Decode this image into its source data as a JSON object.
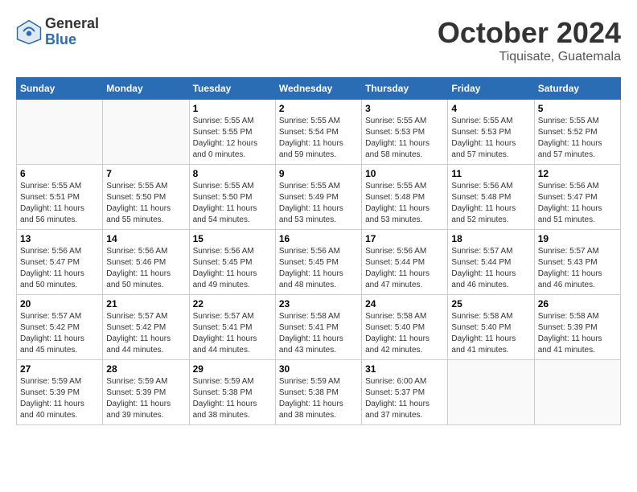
{
  "header": {
    "logo_general": "General",
    "logo_blue": "Blue",
    "month_title": "October 2024",
    "location": "Tiquisate, Guatemala"
  },
  "weekdays": [
    "Sunday",
    "Monday",
    "Tuesday",
    "Wednesday",
    "Thursday",
    "Friday",
    "Saturday"
  ],
  "weeks": [
    [
      {
        "day": "",
        "empty": true
      },
      {
        "day": "",
        "empty": true
      },
      {
        "day": "1",
        "sunrise": "Sunrise: 5:55 AM",
        "sunset": "Sunset: 5:55 PM",
        "daylight": "Daylight: 12 hours and 0 minutes."
      },
      {
        "day": "2",
        "sunrise": "Sunrise: 5:55 AM",
        "sunset": "Sunset: 5:54 PM",
        "daylight": "Daylight: 11 hours and 59 minutes."
      },
      {
        "day": "3",
        "sunrise": "Sunrise: 5:55 AM",
        "sunset": "Sunset: 5:53 PM",
        "daylight": "Daylight: 11 hours and 58 minutes."
      },
      {
        "day": "4",
        "sunrise": "Sunrise: 5:55 AM",
        "sunset": "Sunset: 5:53 PM",
        "daylight": "Daylight: 11 hours and 57 minutes."
      },
      {
        "day": "5",
        "sunrise": "Sunrise: 5:55 AM",
        "sunset": "Sunset: 5:52 PM",
        "daylight": "Daylight: 11 hours and 57 minutes."
      }
    ],
    [
      {
        "day": "6",
        "sunrise": "Sunrise: 5:55 AM",
        "sunset": "Sunset: 5:51 PM",
        "daylight": "Daylight: 11 hours and 56 minutes."
      },
      {
        "day": "7",
        "sunrise": "Sunrise: 5:55 AM",
        "sunset": "Sunset: 5:50 PM",
        "daylight": "Daylight: 11 hours and 55 minutes."
      },
      {
        "day": "8",
        "sunrise": "Sunrise: 5:55 AM",
        "sunset": "Sunset: 5:50 PM",
        "daylight": "Daylight: 11 hours and 54 minutes."
      },
      {
        "day": "9",
        "sunrise": "Sunrise: 5:55 AM",
        "sunset": "Sunset: 5:49 PM",
        "daylight": "Daylight: 11 hours and 53 minutes."
      },
      {
        "day": "10",
        "sunrise": "Sunrise: 5:55 AM",
        "sunset": "Sunset: 5:48 PM",
        "daylight": "Daylight: 11 hours and 53 minutes."
      },
      {
        "day": "11",
        "sunrise": "Sunrise: 5:56 AM",
        "sunset": "Sunset: 5:48 PM",
        "daylight": "Daylight: 11 hours and 52 minutes."
      },
      {
        "day": "12",
        "sunrise": "Sunrise: 5:56 AM",
        "sunset": "Sunset: 5:47 PM",
        "daylight": "Daylight: 11 hours and 51 minutes."
      }
    ],
    [
      {
        "day": "13",
        "sunrise": "Sunrise: 5:56 AM",
        "sunset": "Sunset: 5:47 PM",
        "daylight": "Daylight: 11 hours and 50 minutes."
      },
      {
        "day": "14",
        "sunrise": "Sunrise: 5:56 AM",
        "sunset": "Sunset: 5:46 PM",
        "daylight": "Daylight: 11 hours and 50 minutes."
      },
      {
        "day": "15",
        "sunrise": "Sunrise: 5:56 AM",
        "sunset": "Sunset: 5:45 PM",
        "daylight": "Daylight: 11 hours and 49 minutes."
      },
      {
        "day": "16",
        "sunrise": "Sunrise: 5:56 AM",
        "sunset": "Sunset: 5:45 PM",
        "daylight": "Daylight: 11 hours and 48 minutes."
      },
      {
        "day": "17",
        "sunrise": "Sunrise: 5:56 AM",
        "sunset": "Sunset: 5:44 PM",
        "daylight": "Daylight: 11 hours and 47 minutes."
      },
      {
        "day": "18",
        "sunrise": "Sunrise: 5:57 AM",
        "sunset": "Sunset: 5:44 PM",
        "daylight": "Daylight: 11 hours and 46 minutes."
      },
      {
        "day": "19",
        "sunrise": "Sunrise: 5:57 AM",
        "sunset": "Sunset: 5:43 PM",
        "daylight": "Daylight: 11 hours and 46 minutes."
      }
    ],
    [
      {
        "day": "20",
        "sunrise": "Sunrise: 5:57 AM",
        "sunset": "Sunset: 5:42 PM",
        "daylight": "Daylight: 11 hours and 45 minutes."
      },
      {
        "day": "21",
        "sunrise": "Sunrise: 5:57 AM",
        "sunset": "Sunset: 5:42 PM",
        "daylight": "Daylight: 11 hours and 44 minutes."
      },
      {
        "day": "22",
        "sunrise": "Sunrise: 5:57 AM",
        "sunset": "Sunset: 5:41 PM",
        "daylight": "Daylight: 11 hours and 44 minutes."
      },
      {
        "day": "23",
        "sunrise": "Sunrise: 5:58 AM",
        "sunset": "Sunset: 5:41 PM",
        "daylight": "Daylight: 11 hours and 43 minutes."
      },
      {
        "day": "24",
        "sunrise": "Sunrise: 5:58 AM",
        "sunset": "Sunset: 5:40 PM",
        "daylight": "Daylight: 11 hours and 42 minutes."
      },
      {
        "day": "25",
        "sunrise": "Sunrise: 5:58 AM",
        "sunset": "Sunset: 5:40 PM",
        "daylight": "Daylight: 11 hours and 41 minutes."
      },
      {
        "day": "26",
        "sunrise": "Sunrise: 5:58 AM",
        "sunset": "Sunset: 5:39 PM",
        "daylight": "Daylight: 11 hours and 41 minutes."
      }
    ],
    [
      {
        "day": "27",
        "sunrise": "Sunrise: 5:59 AM",
        "sunset": "Sunset: 5:39 PM",
        "daylight": "Daylight: 11 hours and 40 minutes."
      },
      {
        "day": "28",
        "sunrise": "Sunrise: 5:59 AM",
        "sunset": "Sunset: 5:39 PM",
        "daylight": "Daylight: 11 hours and 39 minutes."
      },
      {
        "day": "29",
        "sunrise": "Sunrise: 5:59 AM",
        "sunset": "Sunset: 5:38 PM",
        "daylight": "Daylight: 11 hours and 38 minutes."
      },
      {
        "day": "30",
        "sunrise": "Sunrise: 5:59 AM",
        "sunset": "Sunset: 5:38 PM",
        "daylight": "Daylight: 11 hours and 38 minutes."
      },
      {
        "day": "31",
        "sunrise": "Sunrise: 6:00 AM",
        "sunset": "Sunset: 5:37 PM",
        "daylight": "Daylight: 11 hours and 37 minutes."
      },
      {
        "day": "",
        "empty": true
      },
      {
        "day": "",
        "empty": true
      }
    ]
  ]
}
